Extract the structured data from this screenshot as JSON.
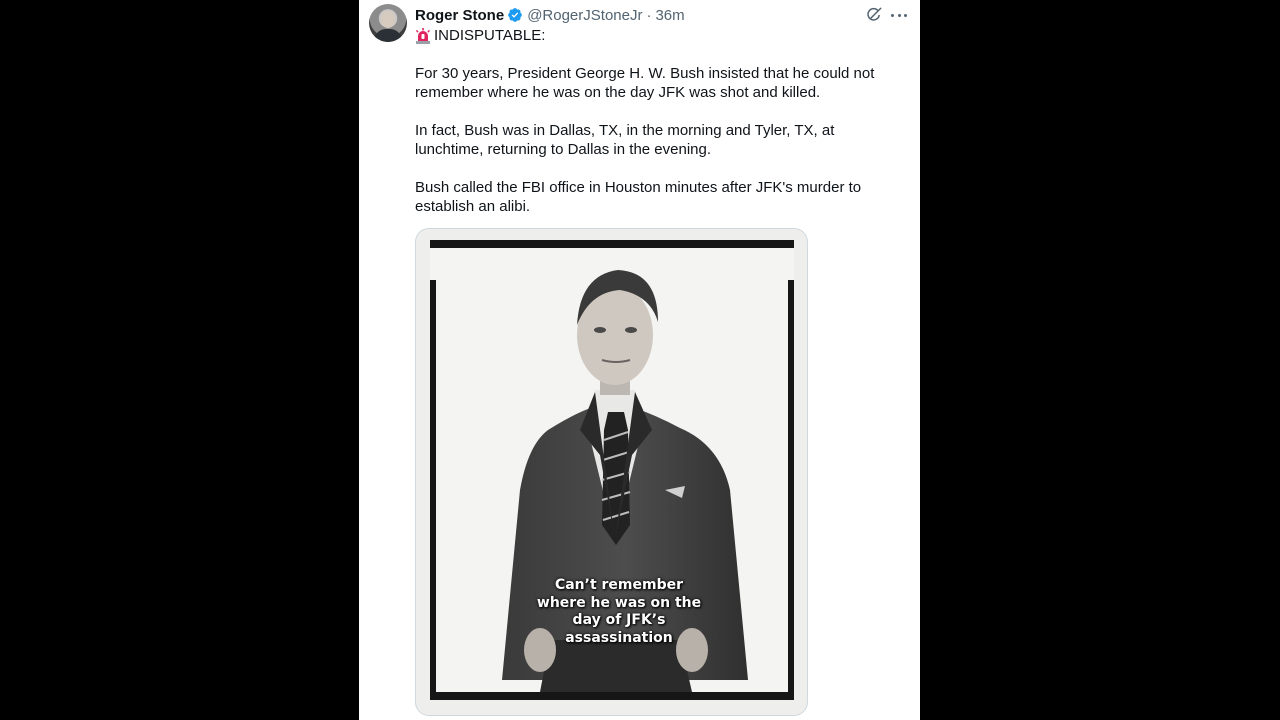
{
  "author": {
    "display_name": "Roger Stone",
    "handle": "@RogerJStoneJr",
    "separator": "·",
    "timestamp": "36m",
    "verified": true,
    "avatar_icon": "profile-photo"
  },
  "post": {
    "alert_emoji_icon": "rotating-light-icon",
    "alert_text": "INDISPUTABLE:",
    "paragraphs": [
      "For 30 years, President George H. W. Bush insisted that he could not remember where he was on the day JFK was shot and killed.",
      "In fact, Bush was in Dallas, TX, in the morning and Tyler, TX, at lunchtime, returning to Dallas in the evening.",
      "Bush called the FBI office in Houston minutes after JFK's murder to establish an alibi."
    ]
  },
  "media": {
    "caption": "Can’t remember where he was on the day of JFK’s assassination"
  },
  "icons": {
    "verified": "verified-badge-icon",
    "grok": "grok-icon",
    "more": "more-options-icon"
  },
  "colors": {
    "verified_blue": "#1d9bf0",
    "text_primary": "#0f1419",
    "text_secondary": "#536471",
    "alert_red": "#e0245e"
  }
}
